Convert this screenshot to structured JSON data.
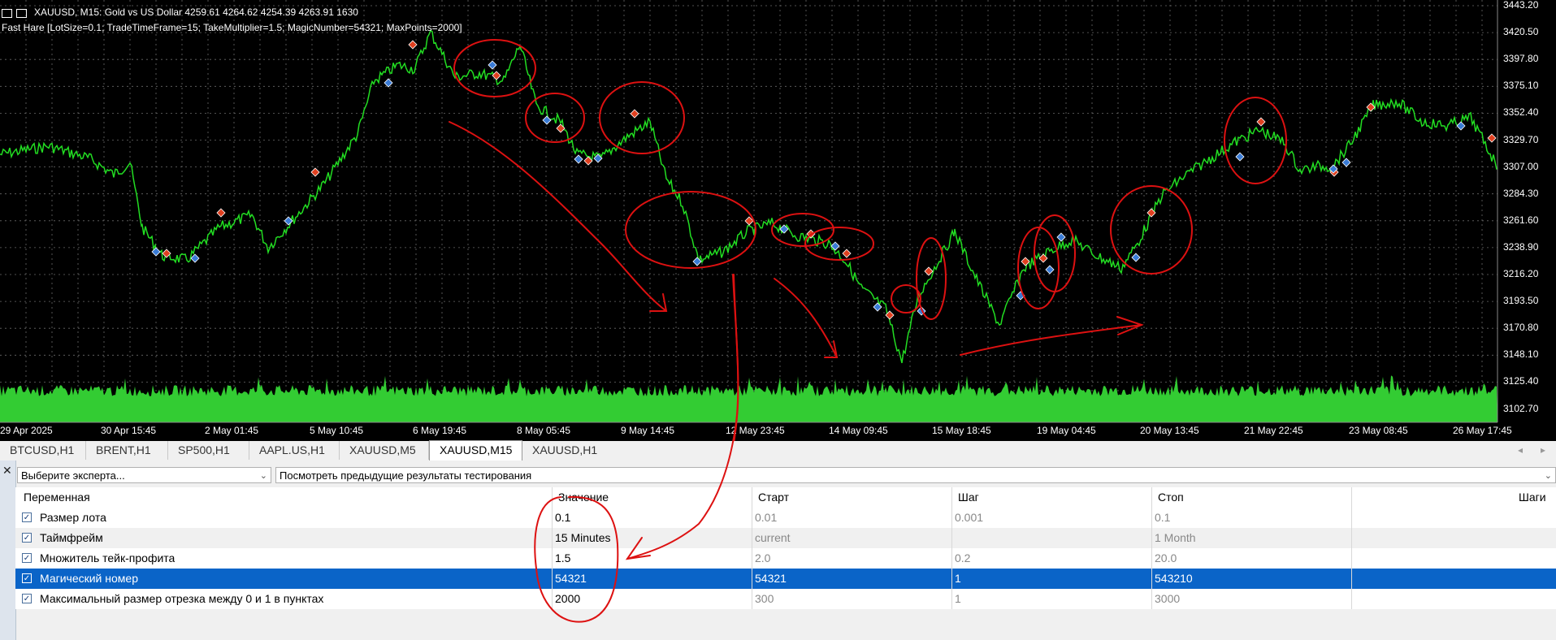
{
  "chart": {
    "symbol_line": "XAUUSD, M15:  Gold vs US Dollar  4259.61 4264.62 4254.39 4263.91  1630",
    "expert_line": "Fast Hare [LotSize=0.1; TradeTimeFrame=15; TakeMultiplier=1.5; MagicNumber=54321; MaxPoints=2000]",
    "price_labels": [
      "3443.20",
      "3420.50",
      "3397.80",
      "3375.10",
      "3352.40",
      "3329.70",
      "3307.00",
      "3284.30",
      "3261.60",
      "3238.90",
      "3216.20",
      "3193.50",
      "3170.80",
      "3148.10",
      "3125.40",
      "3102.70"
    ],
    "time_labels": [
      "29 Apr 2025",
      "30 Apr 15:45",
      "2 May 01:45",
      "5 May 10:45",
      "6 May 19:45",
      "8 May 05:45",
      "9 May 14:45",
      "12 May 23:45",
      "14 May 09:45",
      "15 May 18:45",
      "19 May 04:45",
      "20 May 13:45",
      "21 May 22:45",
      "23 May 08:45",
      "26 May 17:45"
    ],
    "colors": {
      "background": "#000000",
      "price_line": "#22dd22",
      "volume": "#33cc33",
      "annotation": "#dd1111",
      "buy_marker": "#3a7bd5",
      "sell_marker": "#e04020"
    }
  },
  "tabs": [
    "BTCUSD,H1",
    "BRENT,H1",
    "SP500,H1",
    "AAPL.US,H1",
    "XAUUSD,M5",
    "XAUUSD,M15",
    "XAUUSD,H1"
  ],
  "tab_nav": {
    "left": "◂",
    "right": "▸"
  },
  "tester": {
    "close_icon": "✕",
    "expert_select": "Выберите эксперта...",
    "history_select": "Посмотреть предыдущие результаты тестирования",
    "columns": [
      "Переменная",
      "Значение",
      "Старт",
      "Шаг",
      "Стоп",
      "Шаги"
    ],
    "rows": [
      {
        "name": "Размер лота",
        "value": "0.1",
        "start": "0.01",
        "step": "0.001",
        "stop": "0.1"
      },
      {
        "name": "Таймфрейм",
        "value": "15 Minutes",
        "start": "current",
        "step": "",
        "stop": "1 Month"
      },
      {
        "name": "Множитель тейк-профита",
        "value": "1.5",
        "start": "2.0",
        "step": "0.2",
        "stop": "20.0"
      },
      {
        "name": "Магический номер",
        "value": "54321",
        "start": "54321",
        "step": "1",
        "stop": "543210"
      },
      {
        "name": "Максимальный размер отрезка между 0 и 1 в пунктах",
        "value": "2000",
        "start": "300",
        "step": "1",
        "stop": "3000"
      }
    ]
  }
}
